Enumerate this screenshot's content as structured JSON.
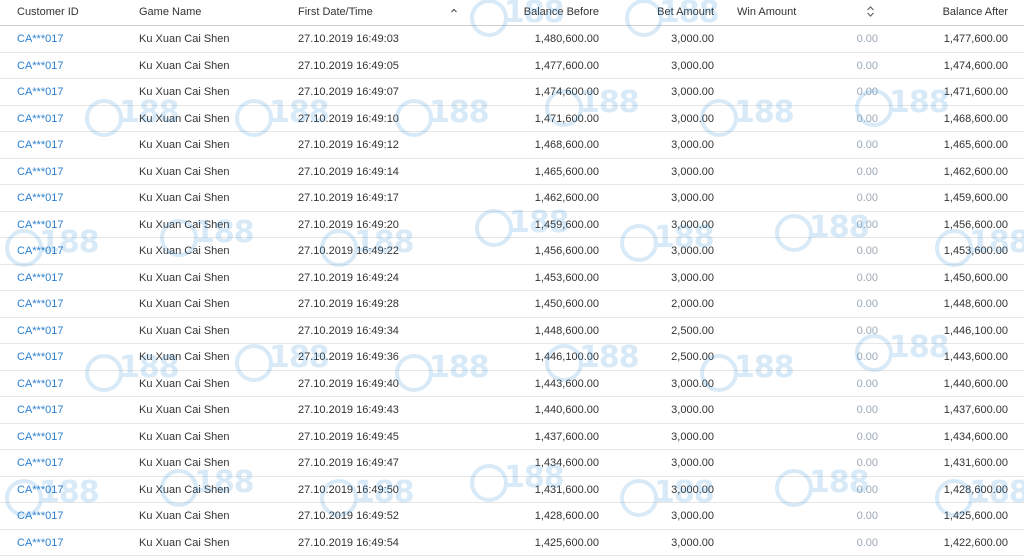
{
  "columns": {
    "customer_id": "Customer ID",
    "game_name": "Game Name",
    "first_datetime": "First Date/Time",
    "balance_before": "Balance Before",
    "bet_amount": "Bet Amount",
    "win_amount": "Win Amount",
    "balance_after": "Balance After"
  },
  "watermark": {
    "brand": "CO188",
    "color": "#2b8fd9"
  },
  "colors": {
    "link": "#2b7fd0",
    "muted": "#9aa9b8",
    "border": "#e6e6e6"
  },
  "rows": [
    {
      "customer_id": "CA***017",
      "game": "Ku Xuan Cai Shen",
      "datetime": "27.10.2019 16:49:03",
      "balance_before": "1,480,600.00",
      "bet": "3,000.00",
      "win": "0.00",
      "balance_after": "1,477,600.00"
    },
    {
      "customer_id": "CA***017",
      "game": "Ku Xuan Cai Shen",
      "datetime": "27.10.2019 16:49:05",
      "balance_before": "1,477,600.00",
      "bet": "3,000.00",
      "win": "0.00",
      "balance_after": "1,474,600.00"
    },
    {
      "customer_id": "CA***017",
      "game": "Ku Xuan Cai Shen",
      "datetime": "27.10.2019 16:49:07",
      "balance_before": "1,474,600.00",
      "bet": "3,000.00",
      "win": "0.00",
      "balance_after": "1,471,600.00"
    },
    {
      "customer_id": "CA***017",
      "game": "Ku Xuan Cai Shen",
      "datetime": "27.10.2019 16:49:10",
      "balance_before": "1,471,600.00",
      "bet": "3,000.00",
      "win": "0.00",
      "balance_after": "1,468,600.00"
    },
    {
      "customer_id": "CA***017",
      "game": "Ku Xuan Cai Shen",
      "datetime": "27.10.2019 16:49:12",
      "balance_before": "1,468,600.00",
      "bet": "3,000.00",
      "win": "0.00",
      "balance_after": "1,465,600.00"
    },
    {
      "customer_id": "CA***017",
      "game": "Ku Xuan Cai Shen",
      "datetime": "27.10.2019 16:49:14",
      "balance_before": "1,465,600.00",
      "bet": "3,000.00",
      "win": "0.00",
      "balance_after": "1,462,600.00"
    },
    {
      "customer_id": "CA***017",
      "game": "Ku Xuan Cai Shen",
      "datetime": "27.10.2019 16:49:17",
      "balance_before": "1,462,600.00",
      "bet": "3,000.00",
      "win": "0.00",
      "balance_after": "1,459,600.00"
    },
    {
      "customer_id": "CA***017",
      "game": "Ku Xuan Cai Shen",
      "datetime": "27.10.2019 16:49:20",
      "balance_before": "1,459,600.00",
      "bet": "3,000.00",
      "win": "0.00",
      "balance_after": "1,456,600.00"
    },
    {
      "customer_id": "CA***017",
      "game": "Ku Xuan Cai Shen",
      "datetime": "27.10.2019 16:49:22",
      "balance_before": "1,456,600.00",
      "bet": "3,000.00",
      "win": "0.00",
      "balance_after": "1,453,600.00"
    },
    {
      "customer_id": "CA***017",
      "game": "Ku Xuan Cai Shen",
      "datetime": "27.10.2019 16:49:24",
      "balance_before": "1,453,600.00",
      "bet": "3,000.00",
      "win": "0.00",
      "balance_after": "1,450,600.00"
    },
    {
      "customer_id": "CA***017",
      "game": "Ku Xuan Cai Shen",
      "datetime": "27.10.2019 16:49:28",
      "balance_before": "1,450,600.00",
      "bet": "2,000.00",
      "win": "0.00",
      "balance_after": "1,448,600.00"
    },
    {
      "customer_id": "CA***017",
      "game": "Ku Xuan Cai Shen",
      "datetime": "27.10.2019 16:49:34",
      "balance_before": "1,448,600.00",
      "bet": "2,500.00",
      "win": "0.00",
      "balance_after": "1,446,100.00"
    },
    {
      "customer_id": "CA***017",
      "game": "Ku Xuan Cai Shen",
      "datetime": "27.10.2019 16:49:36",
      "balance_before": "1,446,100.00",
      "bet": "2,500.00",
      "win": "0.00",
      "balance_after": "1,443,600.00"
    },
    {
      "customer_id": "CA***017",
      "game": "Ku Xuan Cai Shen",
      "datetime": "27.10.2019 16:49:40",
      "balance_before": "1,443,600.00",
      "bet": "3,000.00",
      "win": "0.00",
      "balance_after": "1,440,600.00"
    },
    {
      "customer_id": "CA***017",
      "game": "Ku Xuan Cai Shen",
      "datetime": "27.10.2019 16:49:43",
      "balance_before": "1,440,600.00",
      "bet": "3,000.00",
      "win": "0.00",
      "balance_after": "1,437,600.00"
    },
    {
      "customer_id": "CA***017",
      "game": "Ku Xuan Cai Shen",
      "datetime": "27.10.2019 16:49:45",
      "balance_before": "1,437,600.00",
      "bet": "3,000.00",
      "win": "0.00",
      "balance_after": "1,434,600.00"
    },
    {
      "customer_id": "CA***017",
      "game": "Ku Xuan Cai Shen",
      "datetime": "27.10.2019 16:49:47",
      "balance_before": "1,434,600.00",
      "bet": "3,000.00",
      "win": "0.00",
      "balance_after": "1,431,600.00"
    },
    {
      "customer_id": "CA***017",
      "game": "Ku Xuan Cai Shen",
      "datetime": "27.10.2019 16:49:50",
      "balance_before": "1,431,600.00",
      "bet": "3,000.00",
      "win": "0.00",
      "balance_after": "1,428,600.00"
    },
    {
      "customer_id": "CA***017",
      "game": "Ku Xuan Cai Shen",
      "datetime": "27.10.2019 16:49:52",
      "balance_before": "1,428,600.00",
      "bet": "3,000.00",
      "win": "0.00",
      "balance_after": "1,425,600.00"
    },
    {
      "customer_id": "CA***017",
      "game": "Ku Xuan Cai Shen",
      "datetime": "27.10.2019 16:49:54",
      "balance_before": "1,425,600.00",
      "bet": "3,000.00",
      "win": "0.00",
      "balance_after": "1,422,600.00"
    }
  ]
}
